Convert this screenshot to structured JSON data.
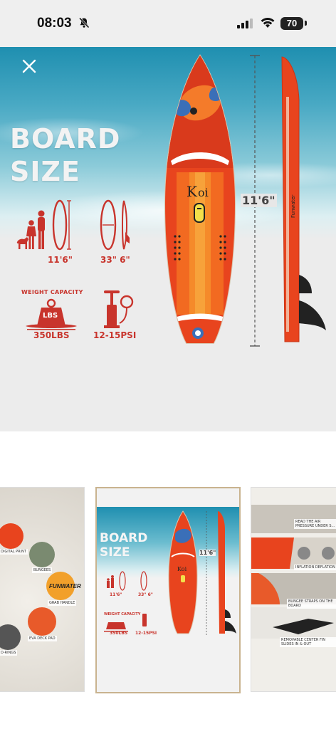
{
  "status": {
    "time": "08:03",
    "battery": "70"
  },
  "hero": {
    "title_line1": "BOARD",
    "title_line2": "SIZE",
    "length_value": "11'6\"",
    "width_value": "33\" 6\"",
    "weight_caption": "WEIGHT CAPACITY",
    "weight_unit_badge": "LBS",
    "weight_value": "350LBS",
    "psi_value": "12-15PSI",
    "board_length_label": "11'6\"",
    "board_brand": "Koi",
    "side_brand": "Funwater",
    "side_tag": "Funwater"
  },
  "thumbnails": [
    {
      "labels": [
        "DIGITAL PRINT",
        "BUNGEES",
        "GRAB HANDLE",
        "EVA DECK PAD",
        "D-RINGS"
      ],
      "logo": "FUNWATER"
    },
    {
      "title_line1": "BOARD",
      "title_line2": "SIZE",
      "length_value": "11'6\"",
      "width_value": "33\" 6\"",
      "weight_caption": "WEIGHT CAPACITY",
      "weight_value": "350LBS",
      "psi_value": "12-15PSI",
      "board_length_label": "11'6\""
    },
    {
      "labels": [
        "READ THE AIR PRESSURE UNDER S...",
        "INFLATION DEFLATION",
        "BUNGEE STRAPS ON THE BOARD",
        "REMOVABLE CENTER FIN SLIDES IN & OUT"
      ]
    }
  ],
  "colors": {
    "accent_red": "#c8342c",
    "selected_border": "#c9b38f",
    "board_orange": "#e8441e"
  }
}
